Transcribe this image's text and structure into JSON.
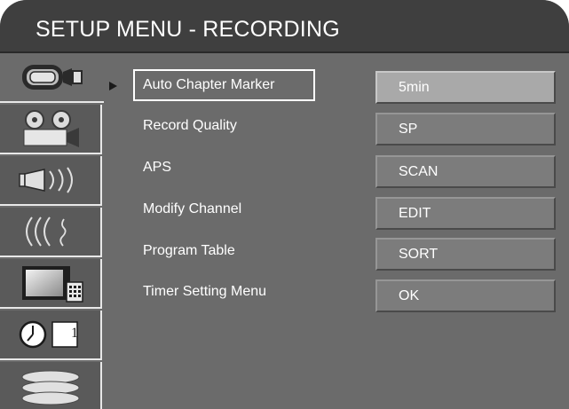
{
  "header": {
    "title": "SETUP MENU - RECORDING"
  },
  "sidebar": {
    "items": [
      {
        "icon": "camcorder-icon",
        "selected": true
      },
      {
        "icon": "film-camera-icon",
        "selected": false
      },
      {
        "icon": "speaker-icon",
        "selected": false
      },
      {
        "icon": "signal-waves-icon",
        "selected": false
      },
      {
        "icon": "tv-remote-icon",
        "selected": false
      },
      {
        "icon": "clock-icon",
        "badge": "1",
        "selected": false
      },
      {
        "icon": "disc-stack-icon",
        "selected": false
      }
    ]
  },
  "menu": {
    "selected_index": 0,
    "items": [
      {
        "label": "Auto Chapter Marker",
        "value": "5min"
      },
      {
        "label": "Record Quality",
        "value": "SP"
      },
      {
        "label": "APS",
        "value": "SCAN"
      },
      {
        "label": "Modify Channel",
        "value": "EDIT"
      },
      {
        "label": "Program Table",
        "value": "SORT"
      },
      {
        "label": "Timer Setting Menu",
        "value": "OK"
      }
    ]
  },
  "colors": {
    "panel": "#6b6b6b",
    "titlebar": "#3f3f3f",
    "highlight_value": "#a9a9a9",
    "value_box": "#7c7c7c"
  }
}
